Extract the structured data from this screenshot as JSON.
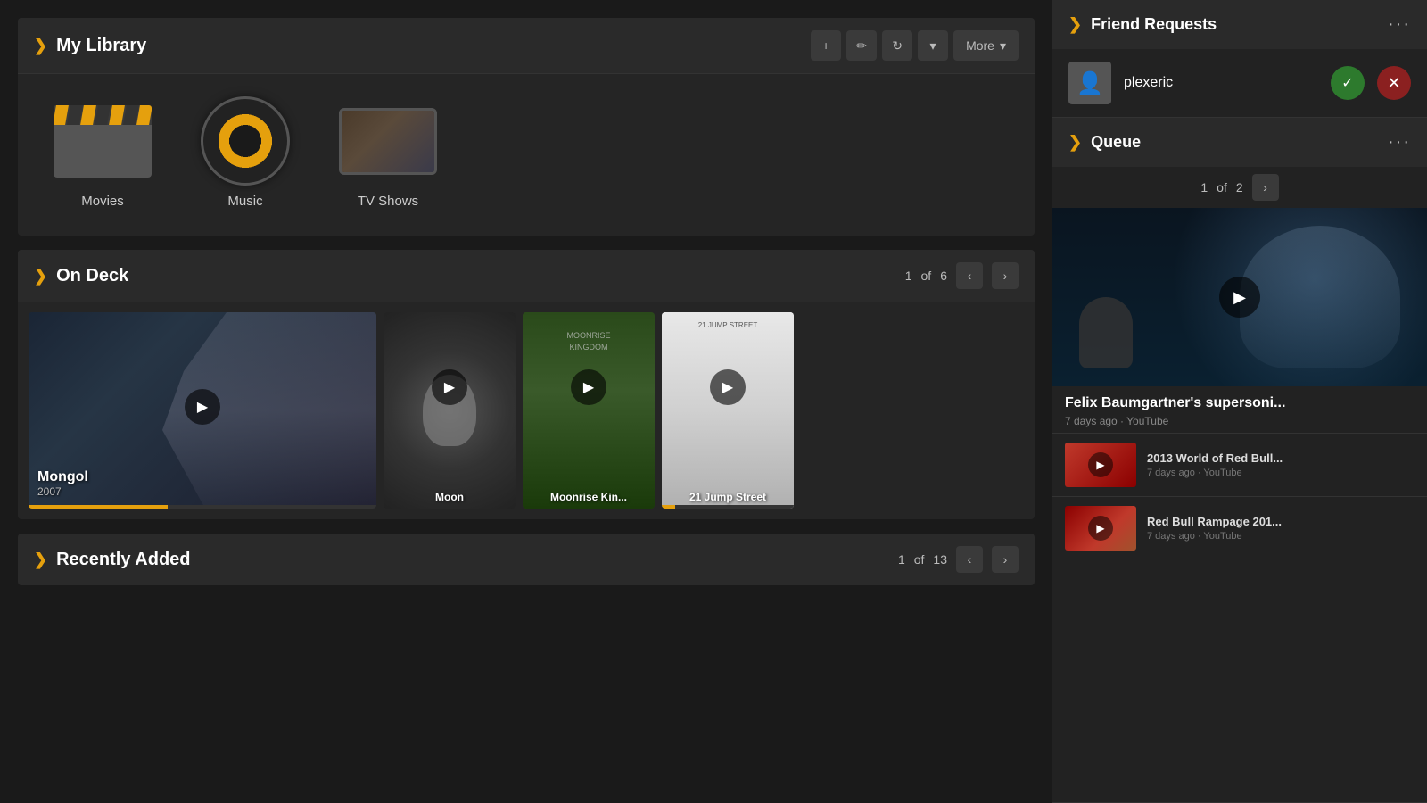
{
  "library": {
    "title": "My Library",
    "items": [
      {
        "label": "Movies",
        "type": "movies"
      },
      {
        "label": "Music",
        "type": "music"
      },
      {
        "label": "TV Shows",
        "type": "tv"
      }
    ],
    "toolbar": {
      "add_label": "+",
      "edit_label": "✏",
      "refresh_label": "↻",
      "dropdown_label": "▾",
      "more_label": "More",
      "more_arrow": "▾"
    }
  },
  "ondeck": {
    "title": "On Deck",
    "pagination": {
      "current": "1",
      "total": "6",
      "of": "of"
    },
    "items": [
      {
        "title": "Mongol",
        "year": "2007",
        "type": "movie",
        "progress": 40
      },
      {
        "title": "Moon",
        "type": "music"
      },
      {
        "title": "Moonrise Kin...",
        "type": "movie"
      },
      {
        "title": "21 Jump Street",
        "type": "movie"
      }
    ]
  },
  "recently_added": {
    "title": "Recently Added",
    "pagination": {
      "current": "1",
      "total": "13",
      "of": "of"
    }
  },
  "friend_requests": {
    "title": "Friend Requests",
    "items": [
      {
        "name": "plexeric"
      }
    ]
  },
  "queue": {
    "title": "Queue",
    "pagination": {
      "current": "1",
      "total": "2",
      "of": "of"
    },
    "main_item": {
      "title": "Felix Baumgartner's supersoni...",
      "meta": "7 days ago · YouTube"
    },
    "items": [
      {
        "title": "2013 World of Red Bull...",
        "meta": "7 days ago · YouTube"
      },
      {
        "title": "Red Bull Rampage 201...",
        "meta": "7 days ago · YouTube"
      }
    ]
  }
}
